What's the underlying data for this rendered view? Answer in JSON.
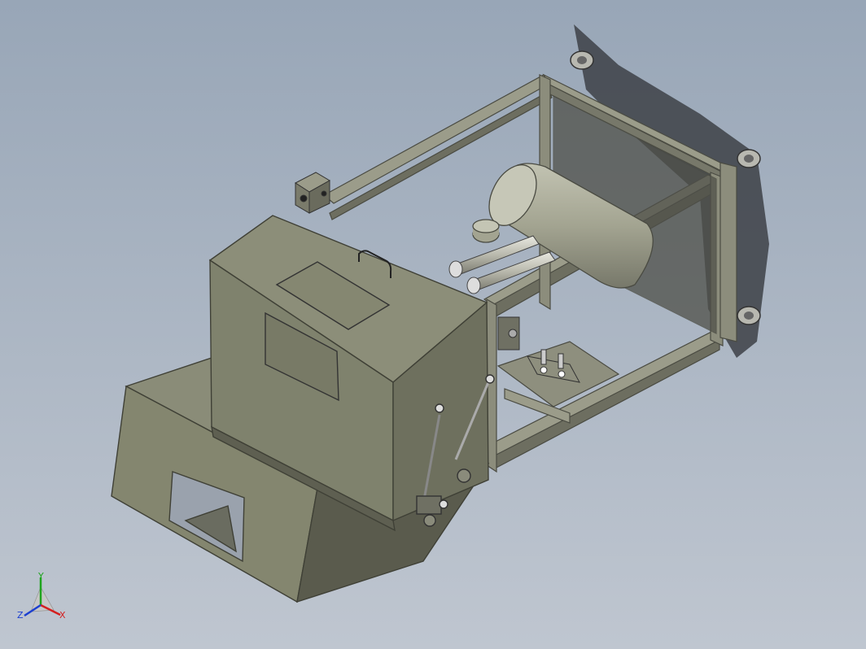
{
  "viewport": {
    "background_top": "#98a6b7",
    "background_bottom": "#bfc6d0"
  },
  "model": {
    "body_color": "#8a8c78",
    "body_dark": "#5f6052",
    "frame_color": "#8c8d7c",
    "tank_color": "#a3a491"
  },
  "triad": {
    "x_label": "X",
    "y_label": "Y",
    "z_label": "Z",
    "x_color": "#d42020",
    "y_color": "#1ea41e",
    "z_color": "#1c3fd0"
  }
}
